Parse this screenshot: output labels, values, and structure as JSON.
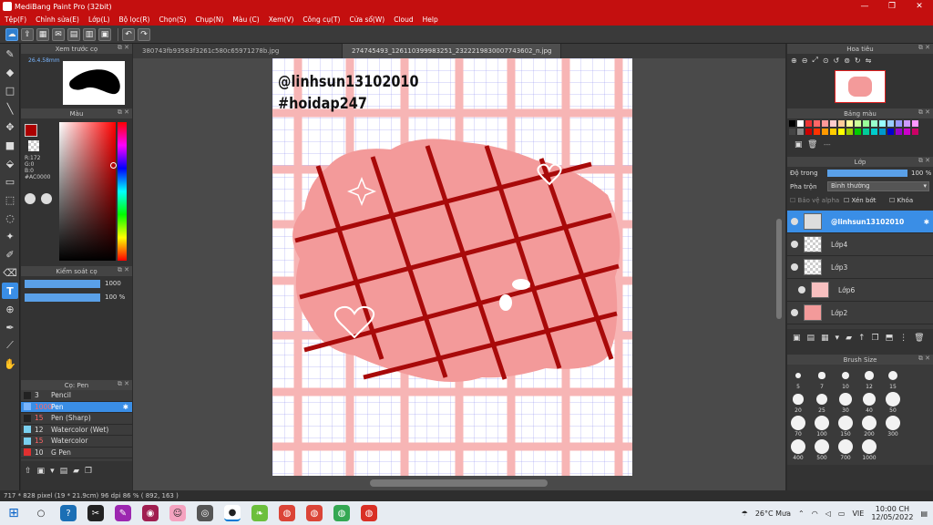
{
  "window": {
    "title": "MediBang Paint Pro (32bit)"
  },
  "menu": [
    "Tệp(F)",
    "Chỉnh sửa(E)",
    "Lớp(L)",
    "Bộ lọc(R)",
    "Chọn(S)",
    "Chụp(N)",
    "Màu (C)",
    "Xem(V)",
    "Công cụ(T)",
    "Cửa sổ(W)",
    "Cloud",
    "Help"
  ],
  "tabs": [
    "380743fb93583f3261c580c65971278b.jpg",
    "274745493_126110399983251_2322219830007743602_n.jpg"
  ],
  "canvas": {
    "line1": "@linhsun13102010",
    "line2": "#hoidap247"
  },
  "preview_panel": {
    "title": "Xem trước cọ",
    "size": "26.4.58mm"
  },
  "color_panel": {
    "title": "Màu",
    "r": "R:172",
    "g": "G:0",
    "b": "B:0",
    "hex": "#AC0000"
  },
  "brush_control": {
    "title": "Kiểm soát cọ",
    "size": "1000",
    "opacity": "100 %"
  },
  "brush_list": {
    "title": "Cọ: Pen",
    "items": [
      {
        "size": "3",
        "name": "Pencil",
        "color": "#222222"
      },
      {
        "size": "1000",
        "name": "Pen",
        "color": "#7ab6ff"
      },
      {
        "size": "15",
        "name": "Pen (Sharp)",
        "color": "#222222"
      },
      {
        "size": "12",
        "name": "Watercolor (Wet)",
        "color": "#7ad0f0"
      },
      {
        "size": "15",
        "name": "Watercolor",
        "color": "#7ad0f0"
      },
      {
        "size": "10",
        "name": "G Pen",
        "color": "#e03030"
      }
    ]
  },
  "navigator": {
    "title": "Hoa tiêu"
  },
  "palette": {
    "title": "Bảng màu",
    "label": "---"
  },
  "layers": {
    "title": "Lớp",
    "opacity_label": "Độ trong",
    "opacity_value": "100 %",
    "blend_label": "Pha trộn",
    "blend_value": "Bình thường",
    "alpha_lock": "Bảo vệ alpha",
    "clipping": "Xén bớt",
    "lock": "Khóa",
    "items": [
      "@linhsun13102010",
      "Lớp4",
      "Lớp3",
      "Lớp6",
      "Lớp2"
    ]
  },
  "brush_size": {
    "title": "Brush Size",
    "values": [
      "5",
      "7",
      "10",
      "12",
      "15",
      "20",
      "25",
      "30",
      "40",
      "50",
      "70",
      "100",
      "150",
      "200",
      "300",
      "400",
      "500",
      "700",
      "1000"
    ]
  },
  "status": {
    "dims": "717 * 828 pixel",
    "cm": "(19 * 21.9cm)",
    "dpi": "96 dpi",
    "zoom": "86 %",
    "coords": "( 892, 163 )"
  },
  "taskbar": {
    "weather": "26°C Mưa",
    "lang": "VIE",
    "time": "10:00 CH",
    "date": "12/05/2022"
  },
  "colors": {
    "accent": "#c40f0f",
    "selection": "#3a8ee6",
    "fill": "#f39a9a",
    "line": "#a80a0a"
  }
}
